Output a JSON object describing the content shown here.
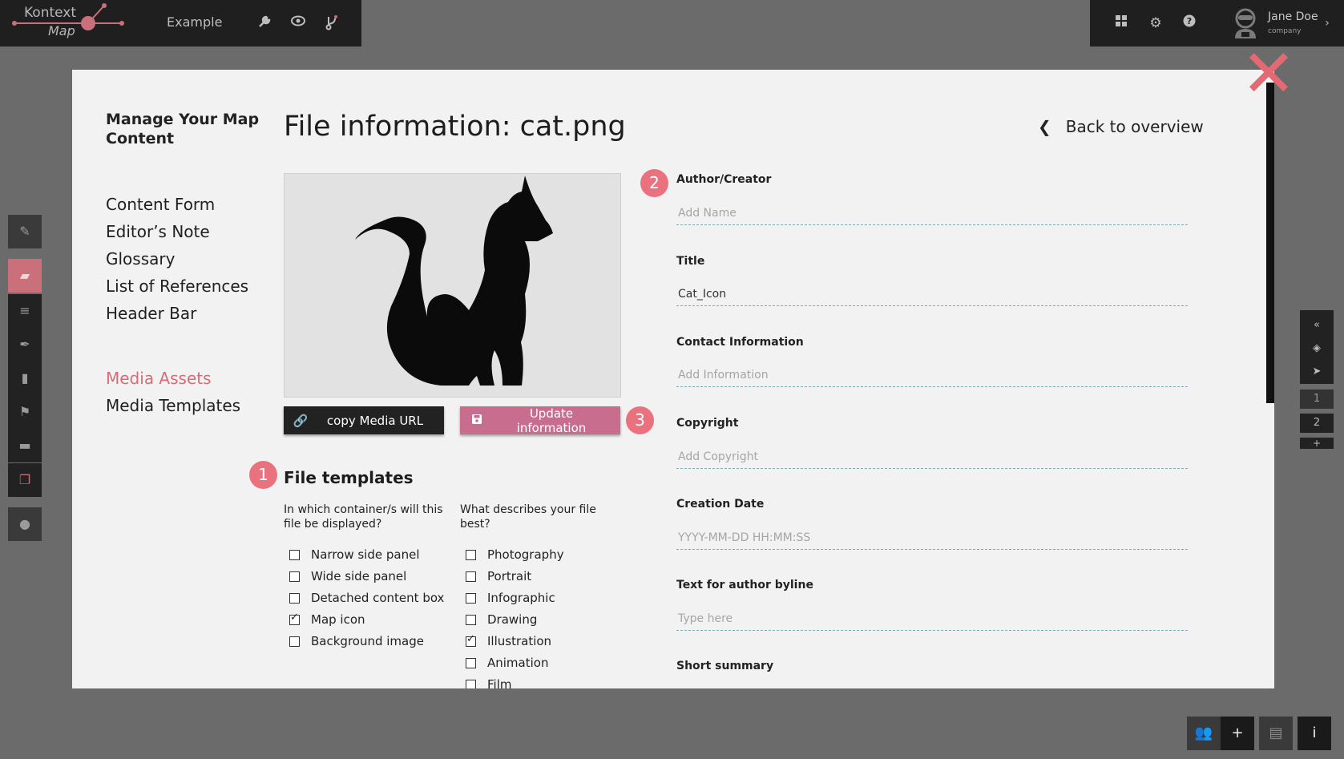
{
  "topbar": {
    "logo_line1": "Kontext",
    "logo_line2": "Map",
    "project": "Example",
    "user_name": "Jane Doe",
    "user_company": "company",
    "icons": [
      "wrench-icon",
      "eye-icon",
      "branch-icon",
      "grid-icon",
      "gear-icon",
      "help-icon"
    ]
  },
  "sidebar": {
    "title": "Manage Your Map Content",
    "items": [
      {
        "label": "Content Form"
      },
      {
        "label": "Editor’s Note"
      },
      {
        "label": "Glossary"
      },
      {
        "label": "List of References"
      },
      {
        "label": "Header Bar"
      },
      {
        "label": "Media Assets"
      },
      {
        "label": "Media Templates"
      }
    ],
    "active_color": "#d66c78"
  },
  "main": {
    "title": "File information: cat.png",
    "back_label": "Back to overview",
    "copy_button": "copy Media URL",
    "update_button": "Update information",
    "badges": [
      "1",
      "2",
      "3"
    ],
    "file_templates": {
      "title": "File templates",
      "container_question": "In which container/s will this file be displayed?",
      "describe_question": "What describes your file best?",
      "containers": [
        {
          "label": "Narrow side panel",
          "checked": false
        },
        {
          "label": "Wide side panel",
          "checked": false
        },
        {
          "label": "Detached content box",
          "checked": false
        },
        {
          "label": "Map icon",
          "checked": true
        },
        {
          "label": "Background image",
          "checked": false
        }
      ],
      "descriptions": [
        {
          "label": "Photography",
          "checked": false
        },
        {
          "label": "Portrait",
          "checked": false
        },
        {
          "label": "Infographic",
          "checked": false
        },
        {
          "label": "Drawing",
          "checked": false
        },
        {
          "label": "Illustration",
          "checked": true
        },
        {
          "label": "Animation",
          "checked": false
        },
        {
          "label": "Film",
          "checked": false
        }
      ]
    },
    "fields": [
      {
        "label": "Author/Creator",
        "value": "",
        "placeholder": "Add Name"
      },
      {
        "label": "Title",
        "value": "Cat_Icon",
        "placeholder": ""
      },
      {
        "label": "Contact Information",
        "value": "",
        "placeholder": "Add Information"
      },
      {
        "label": "Copyright",
        "value": "",
        "placeholder": "Add Copyright"
      },
      {
        "label": "Creation Date",
        "value": "",
        "placeholder": "YYYY-MM-DD HH:MM:SS"
      },
      {
        "label": "Text for author byline",
        "value": "",
        "placeholder": "Type here"
      },
      {
        "label": "Short summary",
        "value": "",
        "placeholder": ""
      }
    ]
  },
  "right_toolbar": {
    "pages": [
      "1",
      "2",
      "+"
    ]
  },
  "colors": {
    "accent": "#e9727e",
    "update_button": "#c96d8e",
    "field_underline": "#7aaeb0"
  }
}
